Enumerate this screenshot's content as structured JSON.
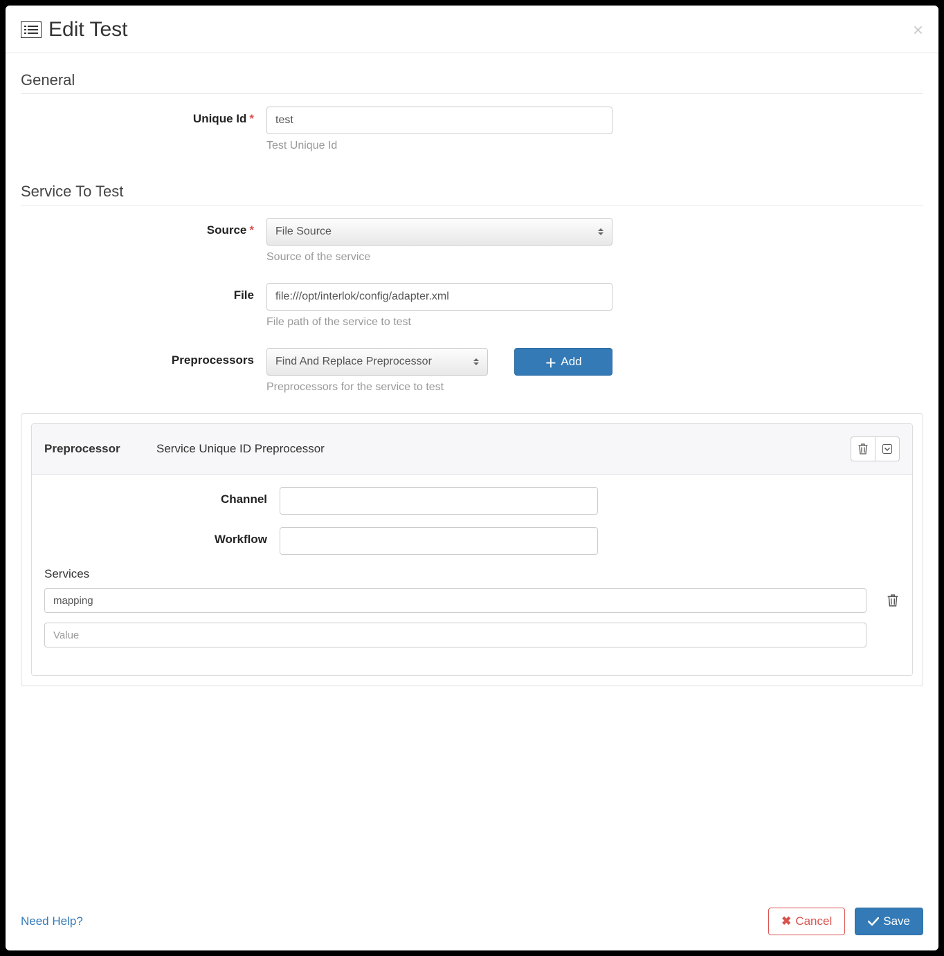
{
  "modal": {
    "title": "Edit Test"
  },
  "sections": {
    "general": "General",
    "service_to_test": "Service To Test"
  },
  "fields": {
    "unique_id": {
      "label": "Unique Id",
      "value": "test",
      "help": "Test Unique Id"
    },
    "source": {
      "label": "Source",
      "value": "File Source",
      "help": "Source of the service"
    },
    "file": {
      "label": "File",
      "value": "file:///opt/interlok/config/adapter.xml",
      "help": "File path of the service to test"
    },
    "preprocessors": {
      "label": "Preprocessors",
      "value": "Find And Replace Preprocessor",
      "help": "Preprocessors for the service to test",
      "add_label": "Add"
    }
  },
  "preprocessor_card": {
    "title": "Preprocessor",
    "subtitle": "Service Unique ID Preprocessor",
    "channel_label": "Channel",
    "channel_value": "",
    "workflow_label": "Workflow",
    "workflow_value": "",
    "services_label": "Services",
    "services": [
      {
        "value": "mapping"
      },
      {
        "value": "",
        "placeholder": "Value"
      }
    ]
  },
  "footer": {
    "help": "Need Help?",
    "cancel": "Cancel",
    "save": "Save"
  }
}
